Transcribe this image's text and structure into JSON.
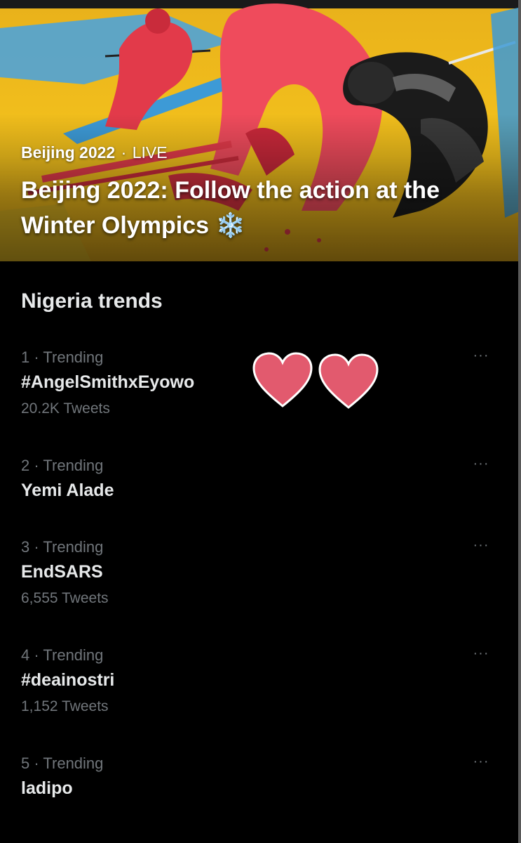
{
  "hero": {
    "category": "Beijing 2022",
    "separator": "·",
    "status": "LIVE",
    "headline": "Beijing 2022: Follow the action at the Winter Olympics",
    "headline_emoji": "❄️"
  },
  "trends_panel": {
    "title": "Nigeria trends",
    "items": [
      {
        "context": "1 · Trending",
        "name": "#AngelSmithxEyowo",
        "count": "20.2K Tweets"
      },
      {
        "context": "2 · Trending",
        "name": "Yemi Alade",
        "count": ""
      },
      {
        "context": "3 · Trending",
        "name": "EndSARS",
        "count": "6,555 Tweets"
      },
      {
        "context": "4 · Trending",
        "name": "#deainostri",
        "count": "1,152 Tweets"
      },
      {
        "context": "5 · Trending",
        "name": "ladipo",
        "count": ""
      }
    ],
    "more_glyph": "···",
    "show_more": ""
  },
  "overlay": {
    "icons": [
      "heart-icon",
      "heart-icon"
    ]
  },
  "colors": {
    "background": "#000000",
    "primary_text": "#e7e9ea",
    "secondary_text": "#71767b",
    "heart": "#e25a6e",
    "banner_yellow": "#f4c21c"
  }
}
